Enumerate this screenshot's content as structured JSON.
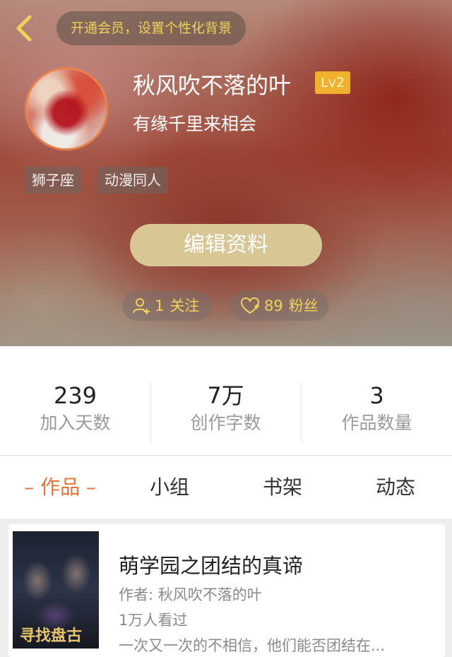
{
  "header": {
    "vip_banner": "开通会员，设置个性化背景"
  },
  "profile": {
    "name": "秋风吹不落的叶",
    "level": "Lv2",
    "signature": "有缘千里来相会",
    "tags": [
      "狮子座",
      "动漫同人"
    ],
    "edit_button": "编辑资料",
    "follow_count": "1",
    "follow_label": "关注",
    "fans_count": "89",
    "fans_label": "粉丝"
  },
  "stats": [
    {
      "value": "239",
      "label": "加入天数"
    },
    {
      "value": "7万",
      "label": "创作字数"
    },
    {
      "value": "3",
      "label": "作品数量"
    }
  ],
  "tabs": [
    "– 作品 –",
    "小组",
    "书架",
    "动态"
  ],
  "active_tab": 0,
  "works": [
    {
      "title": "萌学园之团结的真谛",
      "author": "作者: 秋风吹不落的叶",
      "views": "1万人看过",
      "description": "一次又一次的不相信，他们能否团结在...",
      "cover_text": "寻找盘古"
    }
  ],
  "colors": {
    "accent": "#f0703a",
    "gold": "#f0d25a",
    "level_badge": "#f0b22e",
    "edit_button": "#d8c695"
  },
  "icons": [
    "back-arrow-icon",
    "person-plus-icon",
    "heart-icon"
  ]
}
